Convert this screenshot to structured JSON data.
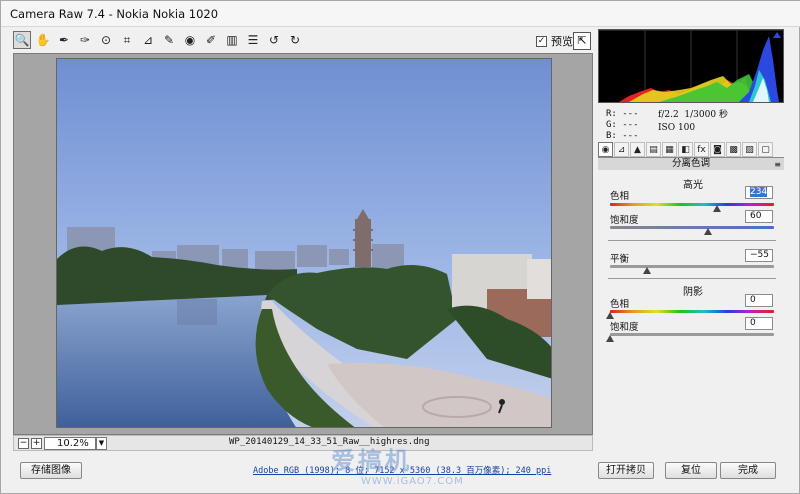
{
  "window": {
    "title": "Camera Raw 7.4 -  Nokia Nokia 1020"
  },
  "toolbar": {
    "tools": [
      {
        "name": "zoom-tool",
        "icon": "🔍"
      },
      {
        "name": "hand-tool",
        "icon": "✋"
      },
      {
        "name": "white-balance-tool",
        "icon": "✒"
      },
      {
        "name": "color-sampler-tool",
        "icon": "✑"
      },
      {
        "name": "targeted-adjustment-tool",
        "icon": "⊙"
      },
      {
        "name": "crop-tool",
        "icon": "⌗"
      },
      {
        "name": "straighten-tool",
        "icon": "⊿"
      },
      {
        "name": "spot-removal-tool",
        "icon": "✎"
      },
      {
        "name": "red-eye-tool",
        "icon": "◉"
      },
      {
        "name": "adjustment-brush-tool",
        "icon": "✐"
      },
      {
        "name": "graduated-filter-tool",
        "icon": "▥"
      },
      {
        "name": "preferences-tool",
        "icon": "☰"
      },
      {
        "name": "rotate-left-tool",
        "icon": "↺"
      },
      {
        "name": "rotate-right-tool",
        "icon": "↻"
      }
    ],
    "preview_label": "预览",
    "preview_checked": "✓",
    "fullscreen_icon": "⇱"
  },
  "status": {
    "zoom_out": "−",
    "zoom_in": "+",
    "zoom_value": "10.2%",
    "zoom_dropdown": "▼",
    "filename": "WP_20140129_14_33_51_Raw__highres.dng"
  },
  "buttons": {
    "save": "存储图像",
    "open_copy": "打开拷贝",
    "reset": "复位",
    "done": "完成"
  },
  "workflow_info": "Adobe RGB (1998); 8 位; 7152 x 5360 (38.3 百万像素); 240 ppi",
  "watermark": {
    "text": "爱搞机",
    "url": "WWW.iGAO7.COM"
  },
  "histogram": {
    "r_label": "R:",
    "r_value": "---",
    "g_label": "G:",
    "g_value": "---",
    "b_label": "B:",
    "b_value": "---",
    "aperture": "f/2.2",
    "shutter": "1/3000 秒",
    "iso": "ISO 100"
  },
  "panel": {
    "tab_icons": [
      "◉",
      "⊿",
      "▲",
      "▤",
      "▦",
      "◧",
      "fx",
      "◙",
      "▩",
      "▨",
      "▢"
    ],
    "section_title": "分离色调",
    "menu_icon": "≡",
    "highlights": {
      "title": "高光",
      "hue_label": "色相",
      "hue_value": "234",
      "hue_fraction": 0.65,
      "saturation_label": "饱和度",
      "saturation_value": "60",
      "saturation_fraction": 0.6
    },
    "balance": {
      "label": "平衡",
      "value": "−55",
      "fraction": 0.225
    },
    "shadows": {
      "title": "阴影",
      "hue_label": "色相",
      "hue_value": "0",
      "hue_fraction": 0,
      "saturation_label": "饱和度",
      "saturation_value": "0",
      "saturation_fraction": 0
    }
  },
  "colors": {
    "accent_select": "#3875d7",
    "link": "#1a3fa5"
  }
}
